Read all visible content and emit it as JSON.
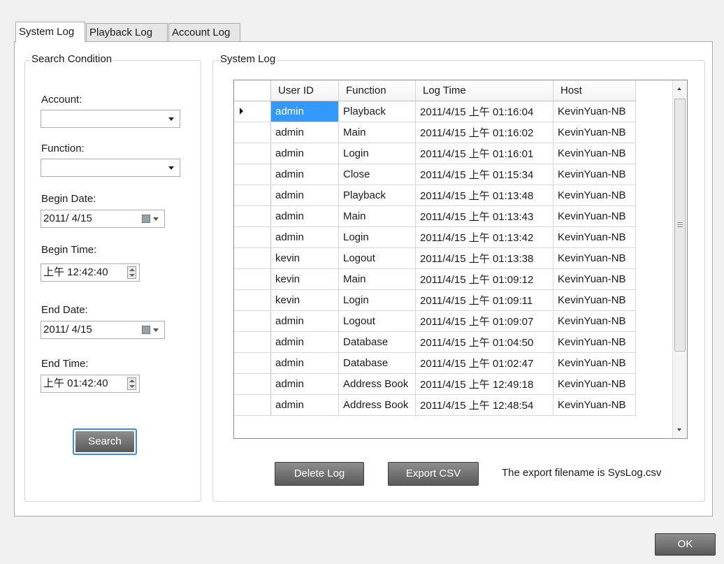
{
  "tabs": [
    {
      "label": "System Log"
    },
    {
      "label": "Playback Log"
    },
    {
      "label": "Account Log"
    }
  ],
  "search": {
    "legend": "Search Condition",
    "account_label": "Account:",
    "account_value": "",
    "function_label": "Function:",
    "function_value": "",
    "begin_date_label": "Begin Date:",
    "begin_date_value": "2011/ 4/15",
    "begin_time_label": "Begin Time:",
    "begin_time_value": "上午 12:42:40",
    "end_date_label": "End Date:",
    "end_date_value": "2011/ 4/15",
    "end_time_label": "End Time:",
    "end_time_value": "上午 01:42:40",
    "search_button": "Search"
  },
  "log": {
    "legend": "System Log",
    "columns": [
      "User ID",
      "Function",
      "Log Time",
      "Host"
    ],
    "rows": [
      {
        "user": "admin",
        "func": "Playback",
        "time": "2011/4/15 上午 01:16:04",
        "host": "KevinYuan-NB"
      },
      {
        "user": "admin",
        "func": "Main",
        "time": "2011/4/15 上午 01:16:02",
        "host": "KevinYuan-NB"
      },
      {
        "user": "admin",
        "func": "Login",
        "time": "2011/4/15 上午 01:16:01",
        "host": "KevinYuan-NB"
      },
      {
        "user": "admin",
        "func": "Close",
        "time": "2011/4/15 上午 01:15:34",
        "host": "KevinYuan-NB"
      },
      {
        "user": "admin",
        "func": "Playback",
        "time": "2011/4/15 上午 01:13:48",
        "host": "KevinYuan-NB"
      },
      {
        "user": "admin",
        "func": "Main",
        "time": "2011/4/15 上午 01:13:43",
        "host": "KevinYuan-NB"
      },
      {
        "user": "admin",
        "func": "Login",
        "time": "2011/4/15 上午 01:13:42",
        "host": "KevinYuan-NB"
      },
      {
        "user": "kevin",
        "func": "Logout",
        "time": "2011/4/15 上午 01:13:38",
        "host": "KevinYuan-NB"
      },
      {
        "user": "kevin",
        "func": "Main",
        "time": "2011/4/15 上午 01:09:12",
        "host": "KevinYuan-NB"
      },
      {
        "user": "kevin",
        "func": "Login",
        "time": "2011/4/15 上午 01:09:11",
        "host": "KevinYuan-NB"
      },
      {
        "user": "admin",
        "func": "Logout",
        "time": "2011/4/15 上午 01:09:07",
        "host": "KevinYuan-NB"
      },
      {
        "user": "admin",
        "func": "Database",
        "time": "2011/4/15 上午 01:04:50",
        "host": "KevinYuan-NB"
      },
      {
        "user": "admin",
        "func": "Database",
        "time": "2011/4/15 上午 01:02:47",
        "host": "KevinYuan-NB"
      },
      {
        "user": "admin",
        "func": "Address Book",
        "time": "2011/4/15 上午 12:49:18",
        "host": "KevinYuan-NB"
      },
      {
        "user": "admin",
        "func": "Address Book",
        "time": "2011/4/15 上午 12:48:54",
        "host": "KevinYuan-NB"
      }
    ],
    "delete_button": "Delete Log",
    "export_button": "Export CSV",
    "export_note": "The export filename is SysLog.csv"
  },
  "ok_button": "OK",
  "colors": {
    "selection": "#3399ff"
  }
}
